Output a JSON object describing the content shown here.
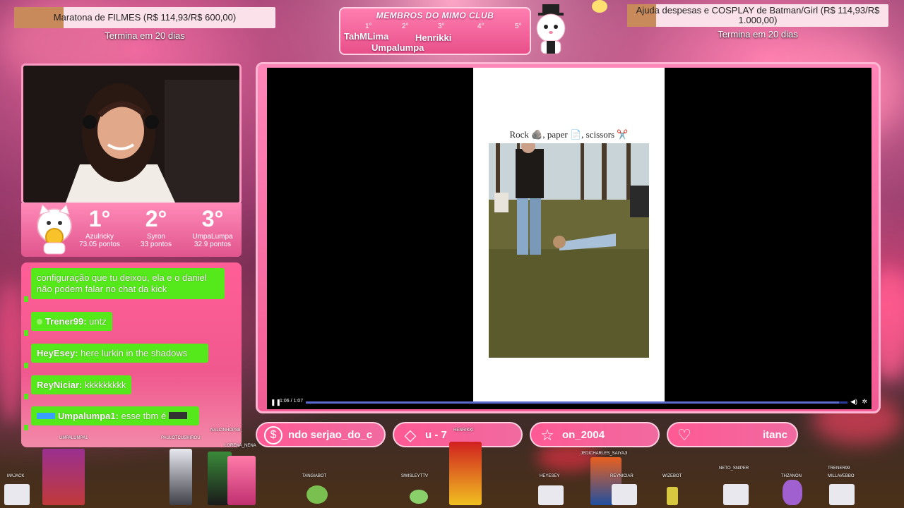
{
  "goals": {
    "left": {
      "label": "Maratona de FILMES (R$ 114,93/R$ 600,00)",
      "subtitle": "Termina em 20 dias",
      "progress": 0.19
    },
    "right": {
      "label": "Ajuda despesas e COSPLAY de Batman/Girl (R$ 114,93/R$ 1.000,00)",
      "subtitle": "Termina em 20 dias",
      "progress": 0.11
    }
  },
  "members": {
    "title": "MEMBROS DO MIMO CLUB",
    "ranks": [
      "1°",
      "2°",
      "3°",
      "4°",
      "5°"
    ],
    "names": [
      "TahMLima",
      "Umpalumpa",
      "Henrikki"
    ]
  },
  "leaderboard": [
    {
      "rank": "1°",
      "name": "Azulricky",
      "points": "73.05 pontos"
    },
    {
      "rank": "2°",
      "name": "Syron",
      "points": "33 pontos"
    },
    {
      "rank": "3°",
      "name": "UmpaLumpa",
      "points": "32.9 pontos"
    }
  ],
  "chat": [
    {
      "user": "",
      "text": "configuração que tu deixou, ela e o daniel não podem falar no chat da kick"
    },
    {
      "user": "Trener99:",
      "text": "untz"
    },
    {
      "user": "HeyEsey:",
      "text": "here lurkin in the shadows"
    },
    {
      "user": "ReyNiciar:",
      "text": "kkkkkkkkk"
    },
    {
      "user": "Umpalumpa1:",
      "text": "esse tbm é"
    }
  ],
  "video": {
    "caption": "Rock 🪨, paper 📄, scissors ✂️",
    "time": "1:06 / 1:07",
    "progress": 0.985
  },
  "ticker": [
    {
      "icon": "coin-icon",
      "text": "ndo  serjao_do_c"
    },
    {
      "icon": "diamond-icon",
      "text": "u - 7"
    },
    {
      "icon": "star-icon",
      "text": "on_2004"
    },
    {
      "icon": "heart-icon",
      "text": "itanc"
    }
  ],
  "viewers": {
    "upper": [
      "UMPALUMPA1",
      "PAULOTCUSHIROU",
      "NALCINHOPS8",
      "LORENA_NENA",
      "HENRIKKI",
      "JEDICHARLES_SAIYAJI"
    ],
    "lower": [
      "MAJACK",
      "TANGIABOT",
      "SWISLEYTTV",
      "HEYESEY",
      "REYNICIAR",
      "WIZEBOT",
      "NETO_SNIPER",
      "THZANON",
      "TRENER99",
      "MILLAVEBBO"
    ]
  },
  "colors": {
    "accent_pink": "#f25b93",
    "chat_green": "#55e81a",
    "goal_fill": "#c88a5a"
  }
}
